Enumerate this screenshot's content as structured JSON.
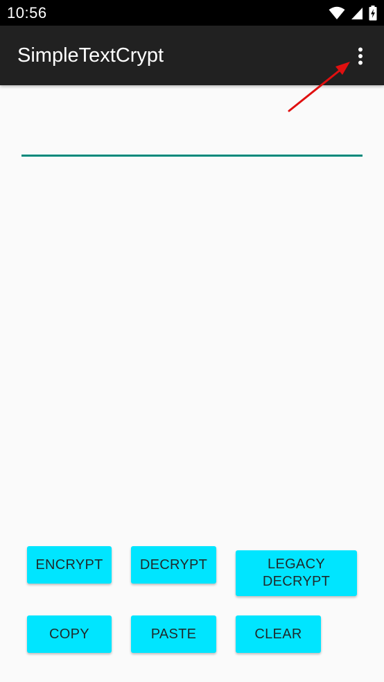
{
  "status_bar": {
    "time": "10:56",
    "icons": [
      "wifi-icon",
      "cellular-signal-icon",
      "battery-charging-icon"
    ]
  },
  "app_bar": {
    "title": "SimpleTextCrypt",
    "overflow_icon": "more-vert-icon"
  },
  "editor": {
    "value": "",
    "placeholder": ""
  },
  "buttons": {
    "encrypt": "ENCRYPT",
    "decrypt": "DECRYPT",
    "legacy_decrypt_line1": "LEGACY",
    "legacy_decrypt_line2": "DECRYPT",
    "copy": "COPY",
    "paste": "PASTE",
    "clear": "CLEAR"
  },
  "colors": {
    "status_bar": "#000000",
    "app_bar": "#212121",
    "background": "#fafafa",
    "accent_underline": "#00897b",
    "button": "#00e5ff",
    "annotation_arrow": "#e01010"
  }
}
